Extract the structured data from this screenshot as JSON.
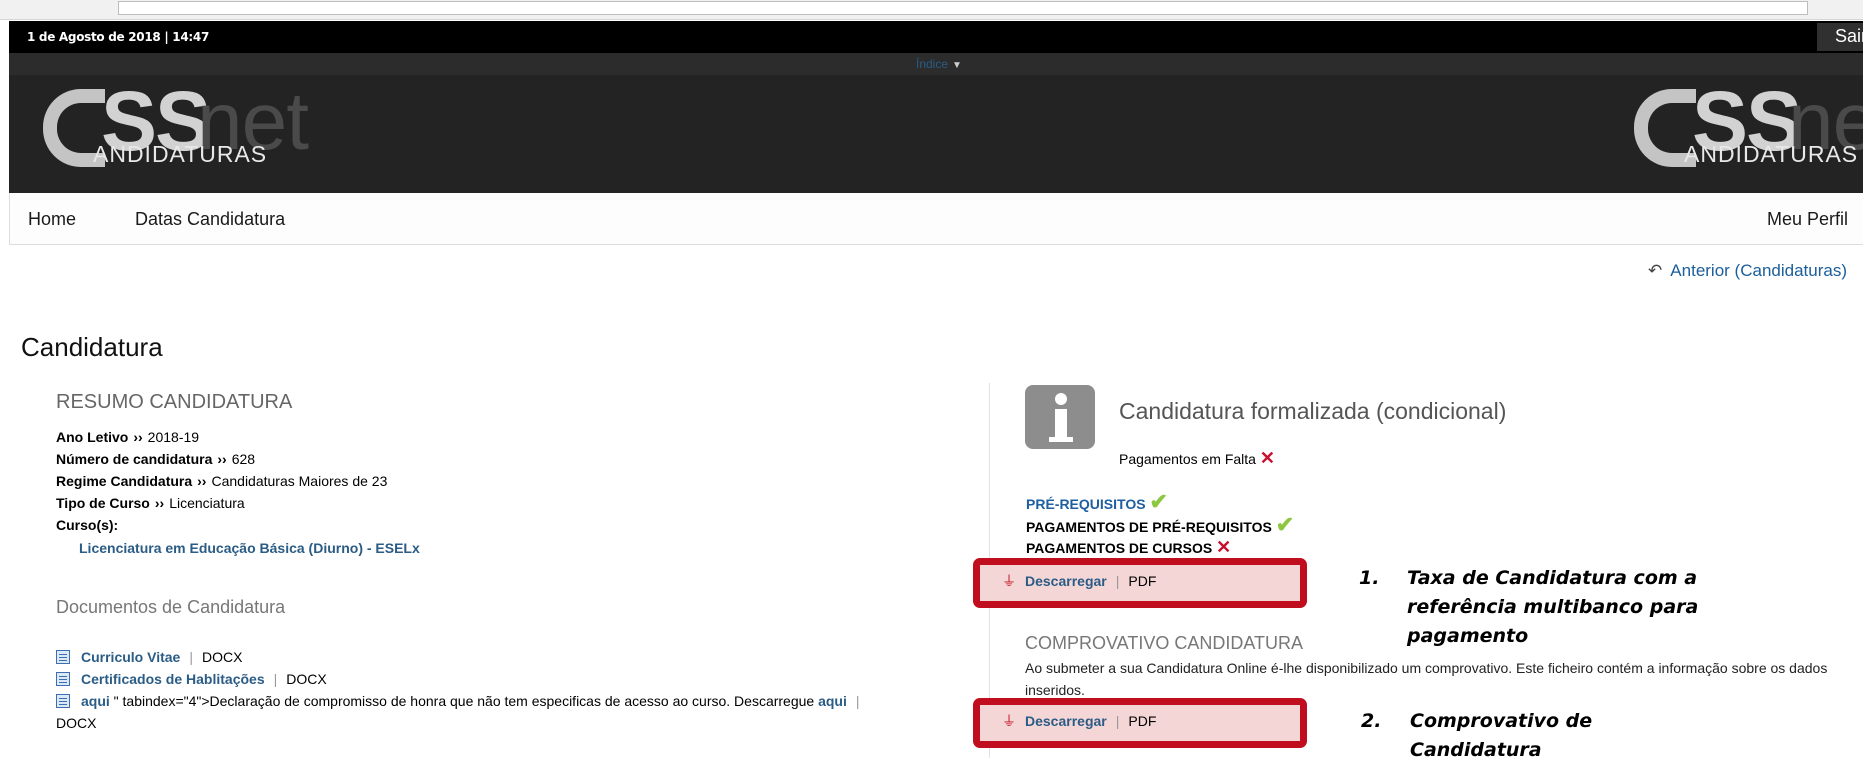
{
  "header": {
    "datetime": "1 de Agosto de 2018 | 14:47",
    "logout_label": "Sair",
    "menu_label": "Índice",
    "logo_left": {
      "ss": "SS",
      "net": "net",
      "cand": "ANDIDATURAS"
    },
    "logo_right": {
      "ss": "SS",
      "net": "net",
      "cand": "ANDIDATURAS"
    }
  },
  "nav": {
    "items": [
      "Home",
      "Datas Candidatura"
    ],
    "profile": "Meu Perfil"
  },
  "back_link": "Anterior (Candidaturas)",
  "page_title": "Candidatura",
  "resumo": {
    "heading": "RESUMO CANDIDATURA",
    "rows": [
      {
        "label": "Ano Letivo",
        "sep": "››",
        "value": "2018-19"
      },
      {
        "label": "Número de candidatura",
        "sep": "››",
        "value": "628"
      },
      {
        "label": "Regime Candidatura",
        "sep": "››",
        "value": "Candidaturas Maiores de 23"
      },
      {
        "label": "Tipo de Curso",
        "sep": "››",
        "value": "Licenciatura"
      }
    ],
    "courses_label": "Curso(s):",
    "course": "Licenciatura em Educação Básica (Diurno) - ESELx"
  },
  "documents": {
    "heading": "Documentos de Candidatura",
    "items": [
      {
        "link": "Curriculo Vitae",
        "type": "DOCX"
      },
      {
        "link": "Certificados de Hablitações",
        "type": "DOCX"
      }
    ],
    "third": {
      "link": "aqui",
      "text": " \" tabindex=\"4\">Declaração de compromisso de honra que não tem especificas de acesso ao curso. Descarregue ",
      "link2": "aqui",
      "type": "DOCX"
    }
  },
  "status": {
    "title": "Candidatura formalizada (condicional)",
    "subtitle": "Pagamentos em Falta",
    "requirements": [
      {
        "label": "PRÉ-REQUISITOS",
        "ok": true,
        "link": true
      },
      {
        "label": "PAGAMENTOS DE PRÉ-REQUISITOS",
        "ok": true,
        "link": false
      },
      {
        "label": "PAGAMENTOS DE CURSOS",
        "ok": false,
        "link": false
      }
    ],
    "download_label": "Descarregar",
    "download_type": "PDF",
    "comprovativo_heading": "COMPROVATIVO CANDIDATURA",
    "comprovativo_text": "Ao submeter a sua Candidatura Online é-lhe disponibilizado um comprovativo. Este ficheiro contém a informação sobre os dados inseridos."
  },
  "annotations": {
    "note1_num": "1.",
    "note1_lines": [
      "Taxa de Candidatura com a",
      "referência multibanco para",
      "pagamento"
    ],
    "note2_num": "2.",
    "note2_lines": [
      "Comprovativo de",
      "Candidatura"
    ]
  },
  "colors": {
    "accent": "#2a5c86",
    "highlight": "#c10e1e",
    "ok": "#8dc63f",
    "error": "#c8102e"
  }
}
